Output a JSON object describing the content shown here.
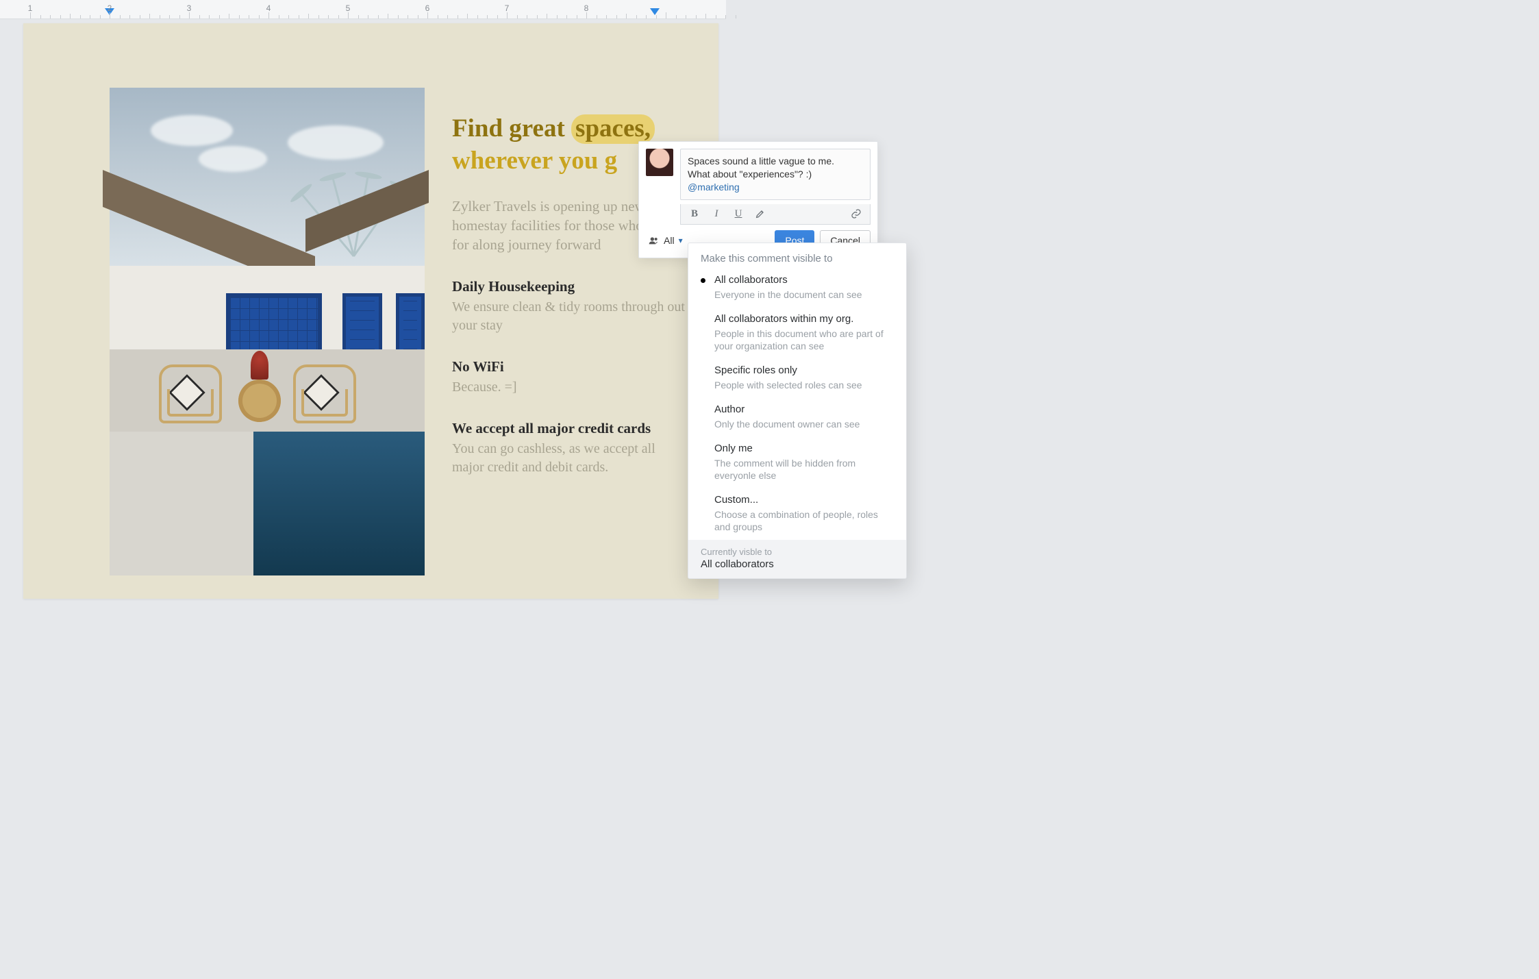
{
  "ruler": {
    "numbers": [
      "1",
      "2",
      "3",
      "4",
      "5",
      "6",
      "7",
      "8"
    ]
  },
  "doc": {
    "headline_line1_pre": "Find great ",
    "headline_highlight": "spaces,",
    "headline_line2": "wherever you g",
    "intro": "Zylker Travels is opening up new homestay facilities for those who are up for along journey forward",
    "features": [
      {
        "title": "Daily Housekeeping",
        "desc": "We ensure clean & tidy rooms through out your stay"
      },
      {
        "title": "No WiFi",
        "desc": "Because. =]"
      },
      {
        "title": "We accept all major credit cards",
        "desc": "You can go cashless, as we accept all major credit and debit cards."
      }
    ]
  },
  "comment": {
    "text_line1": "Spaces sound a little vague to me.",
    "text_line2_pre": "What about \"experiences\"? :) ",
    "mention": "@marketing",
    "audience_label": "All",
    "post": "Post",
    "cancel": "Cancel"
  },
  "visibility": {
    "title": "Make this comment visible to",
    "options": [
      {
        "title": "All collaborators",
        "desc": "Everyone in the document can see",
        "selected": true
      },
      {
        "title": "All collaborators within my org.",
        "desc": "People in this document who are part of your organization can see"
      },
      {
        "title": "Specific roles only",
        "desc": "People with selected roles can see"
      },
      {
        "title": "Author",
        "desc": "Only the document owner can see"
      },
      {
        "title": "Only me",
        "desc": "The comment will be hidden from everyonle else"
      },
      {
        "title": "Custom...",
        "desc": "Choose a combination of people, roles and groups"
      }
    ],
    "footer_label": "Currently visble to",
    "footer_value": "All collaborators"
  }
}
